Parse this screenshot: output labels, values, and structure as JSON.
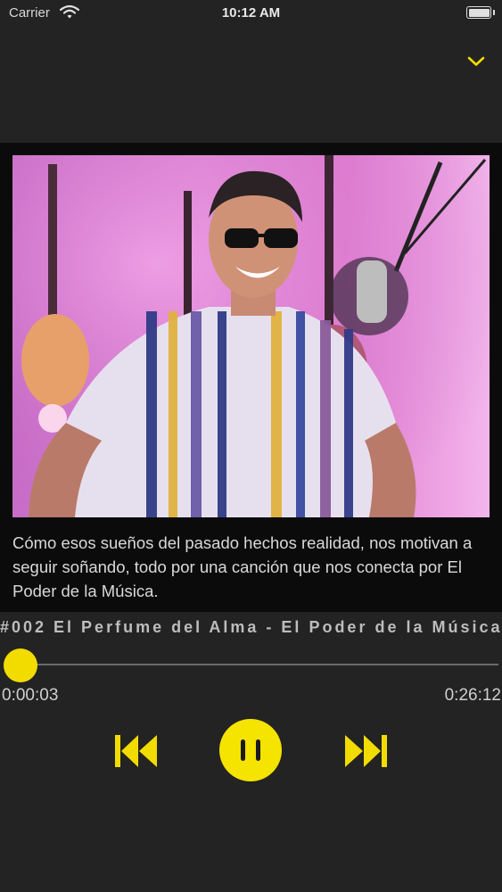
{
  "status_bar": {
    "carrier": "Carrier",
    "time": "10:12 AM"
  },
  "episode": {
    "description": "Cómo esos sueños del pasado hechos realidad, nos motivan a seguir soñando, todo por una canción que nos conecta por El Poder de la Música.",
    "title": "#002 El Perfume del Alma - El Poder de la Música"
  },
  "player": {
    "elapsed": "0:00:03",
    "duration": "0:26:12",
    "progress_fraction": 0.002
  },
  "icons": {
    "collapse": "chevron-down-icon",
    "previous": "skip-back-icon",
    "play_pause": "pause-icon",
    "next": "skip-forward-icon"
  },
  "colors": {
    "accent": "#f2dc00",
    "background": "#232323",
    "panel": "#0b0b0b"
  }
}
